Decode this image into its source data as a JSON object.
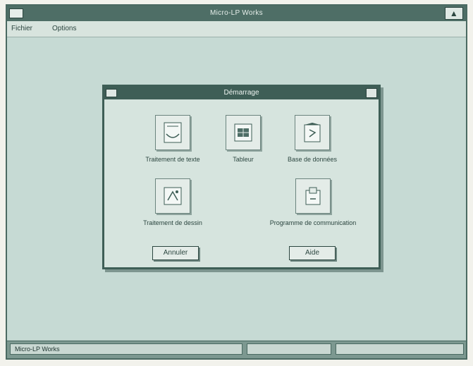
{
  "window": {
    "title": "Micro-LP Works"
  },
  "menu": {
    "items": [
      "Fichier",
      "Options"
    ]
  },
  "dialog": {
    "title": "Démarrage",
    "tools": [
      {
        "label": "Traitement de texte",
        "icon": "document-icon"
      },
      {
        "label": "Tableur",
        "icon": "spreadsheet-icon"
      },
      {
        "label": "Base de données",
        "icon": "database-icon"
      },
      {
        "label": "Traitement de dessin",
        "icon": "drawing-icon"
      },
      {
        "label": "Programme de communication",
        "icon": "communication-icon"
      }
    ],
    "buttons": {
      "ok": "Annuler",
      "cancel": "Aide"
    }
  },
  "status": {
    "text": "Micro-LP Works"
  },
  "colors": {
    "titlebar": "#4e6e66",
    "desktop": "#c6dad4",
    "dialog": "#d6e4de"
  }
}
